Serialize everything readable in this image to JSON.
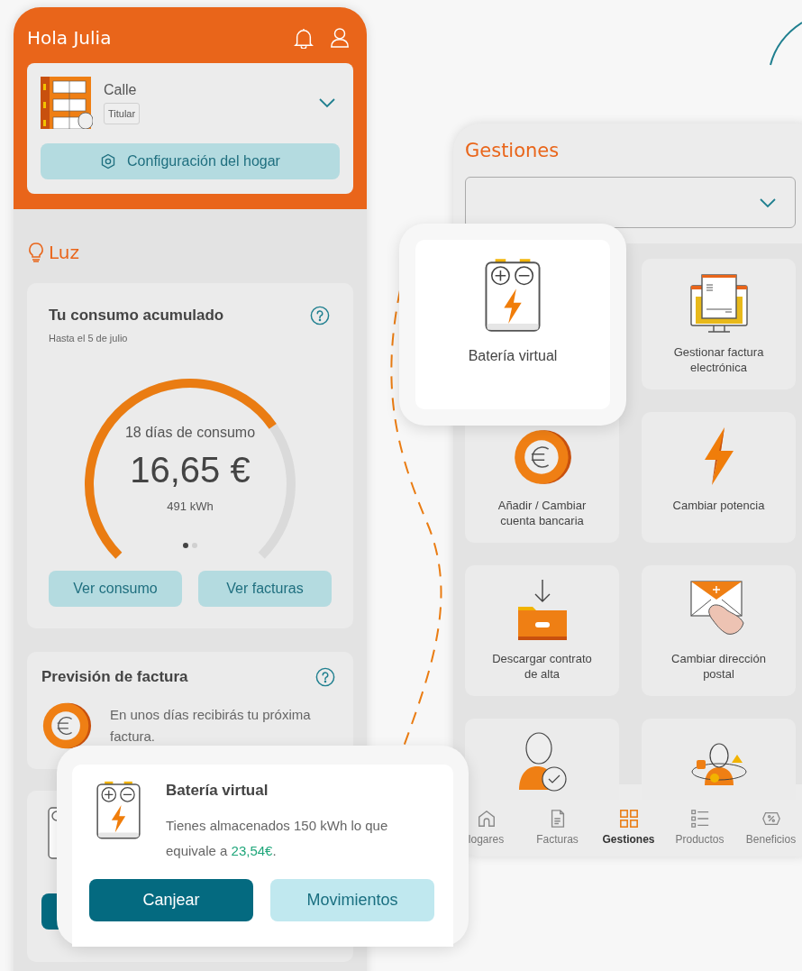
{
  "home": {
    "greeting": "Hola Julia",
    "address": "Calle",
    "role": "Titular",
    "settings_button": "Configuración del hogar"
  },
  "section": {
    "title": "Luz"
  },
  "consumption": {
    "title": "Tu consumo acumulado",
    "subtitle": "Hasta el 5 de julio",
    "days": "18 días de consumo",
    "amount": "16,65 €",
    "energy": "491 kWh",
    "pages": [
      {
        "selected": true
      },
      {
        "selected": false
      }
    ],
    "buttons": [
      "Ver consumo",
      "Ver facturas"
    ]
  },
  "forecast": {
    "title": "Previsión de factura",
    "text": "En unos días recibirás tu próxima factura."
  },
  "gestiones": {
    "title": "Gestiones",
    "tiles": [
      {
        "label": "Gestionar factura electrónica"
      },
      {
        "label": "Añadir / Cambiar cuenta bancaria"
      },
      {
        "label": "Cambiar potencia"
      },
      {
        "label": "Descargar contrato de alta"
      },
      {
        "label": "Cambiar dirección postal"
      }
    ],
    "nav": [
      {
        "label": "logares",
        "selected": false
      },
      {
        "label": "Facturas",
        "selected": false
      },
      {
        "label": "Gestiones",
        "selected": true
      },
      {
        "label": "Productos",
        "selected": false
      },
      {
        "label": "Beneficios",
        "selected": false
      }
    ]
  },
  "battery_popup": {
    "label": "Batería virtual"
  },
  "battery_card": {
    "title": "Batería virtual",
    "text_before": "Tienes almacenados 150 kWh lo que equivale a ",
    "amount": "23,54€",
    "text_after": ".",
    "buttons": [
      {
        "label": "Canjear",
        "kind": "primary"
      },
      {
        "label": "Movimientos",
        "kind": "secondary"
      }
    ]
  }
}
